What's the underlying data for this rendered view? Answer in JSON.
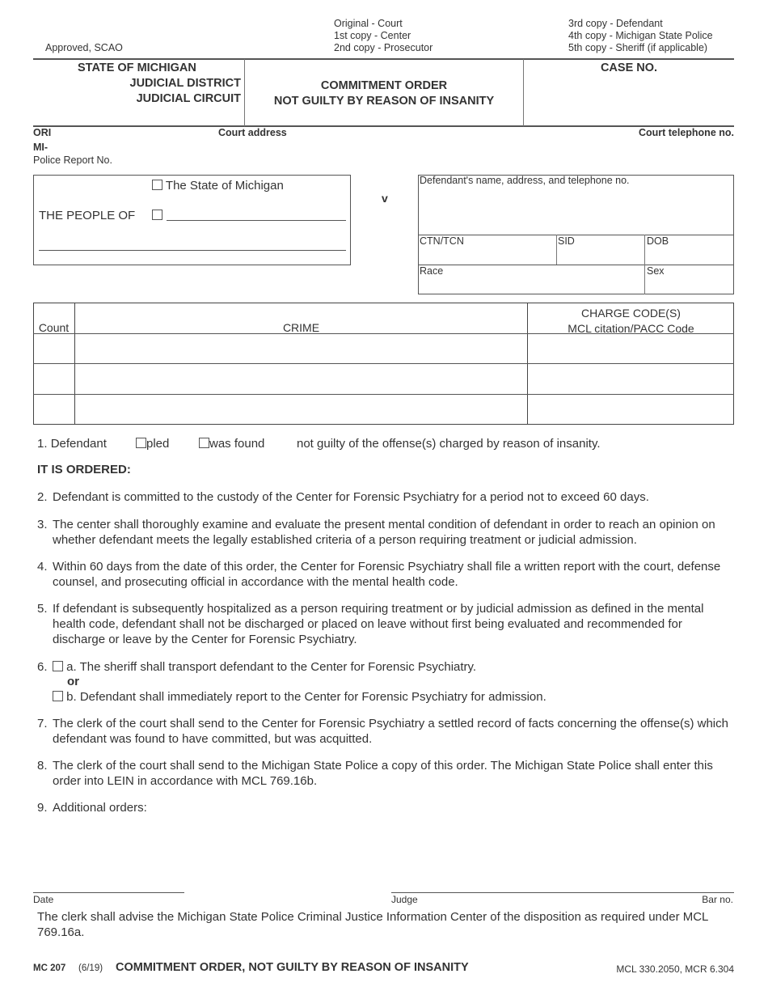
{
  "header": {
    "approved": "Approved, SCAO",
    "distribution_left": [
      "Original - Court",
      "1st copy - Center",
      "2nd copy - Prosecutor"
    ],
    "distribution_right": [
      "3rd copy - Defendant",
      "4th copy - Michigan State Police",
      "5th copy - Sheriff (if applicable)"
    ]
  },
  "court": {
    "state": "STATE OF MICHIGAN",
    "district": "JUDICIAL DISTRICT",
    "circuit": "JUDICIAL CIRCUIT"
  },
  "title": {
    "line1": "COMMITMENT ORDER",
    "line2": "NOT GUILTY BY REASON OF INSANITY"
  },
  "case_no_label": "CASE NO.",
  "info_row": {
    "ori": "ORI",
    "mi": "MI-",
    "police_report": "Police Report No.",
    "court_address": "Court address",
    "court_telephone": "Court telephone no."
  },
  "parties": {
    "people_of": "THE PEOPLE OF",
    "state_option": "The State of Michigan",
    "versus": "v",
    "defendant_label": "Defendant's name, address, and telephone no.",
    "ctn": "CTN/TCN",
    "sid": "SID",
    "dob": "DOB",
    "race": "Race",
    "sex": "Sex"
  },
  "crime_table": {
    "headers": {
      "count": "Count",
      "crime": "CRIME",
      "charge_line1": "CHARGE CODE(S)",
      "charge_line2": "MCL citation/PACC Code"
    },
    "rows": [
      {
        "count": "",
        "crime": "",
        "charge": ""
      },
      {
        "count": "",
        "crime": "",
        "charge": ""
      },
      {
        "count": "",
        "crime": "",
        "charge": ""
      }
    ]
  },
  "finding": {
    "num": "1.",
    "lead": "Defendant",
    "opt_pled": "pled",
    "opt_found": "was found",
    "tail": "not guilty of the offense(s) charged by reason of insanity."
  },
  "ordered_heading": "IT IS ORDERED:",
  "items": [
    {
      "num": "2.",
      "text": "Defendant is committed to the custody of the Center for Forensic Psychiatry for a period not to exceed 60 days."
    },
    {
      "num": "3.",
      "text": "The center shall thoroughly examine and evaluate the present mental condition of defendant in order to reach an opinion on whether defendant meets the legally established criteria of a person requiring treatment or judicial admission."
    },
    {
      "num": "4.",
      "text": "Within 60 days from the date of this order, the Center for Forensic Psychiatry shall file a written report with the court, defense counsel, and prosecuting official in accordance with the mental health code."
    },
    {
      "num": "5.",
      "text": "If defendant is subsequently hospitalized as a person requiring treatment or by judicial admission as defined in the mental health code, defendant shall not be discharged or placed on leave without first being evaluated and recommended for discharge or leave by the Center for Forensic Psychiatry."
    }
  ],
  "item6": {
    "num": "6.",
    "a": "a.  The sheriff shall transport defendant to the Center for Forensic Psychiatry.",
    "or": "or",
    "b": "b.  Defendant shall immediately report to the Center for Forensic Psychiatry for admission."
  },
  "items_later": [
    {
      "num": "7.",
      "text": "The clerk of the court shall send to the Center for Forensic Psychiatry a settled record of facts concerning the offense(s) which defendant was found to have committed, but was acquitted."
    },
    {
      "num": "8.",
      "text": "The clerk of the court shall send to the Michigan State Police a copy of this order. The Michigan State Police shall enter this order into LEIN in accordance with MCL 769.16b."
    },
    {
      "num": "9.",
      "text": "Additional orders:"
    }
  ],
  "signature": {
    "date": "Date",
    "judge": "Judge",
    "bar_no": "Bar no."
  },
  "clerk_notice": "The clerk shall advise the Michigan State Police Criminal Justice Information Center of the disposition as required under MCL 769.16a.",
  "footer": {
    "form_no": "MC 207",
    "rev": "(6/19)",
    "title": "COMMITMENT ORDER, NOT GUILTY BY REASON OF INSANITY",
    "authority": "MCL 330.2050, MCR 6.304"
  }
}
